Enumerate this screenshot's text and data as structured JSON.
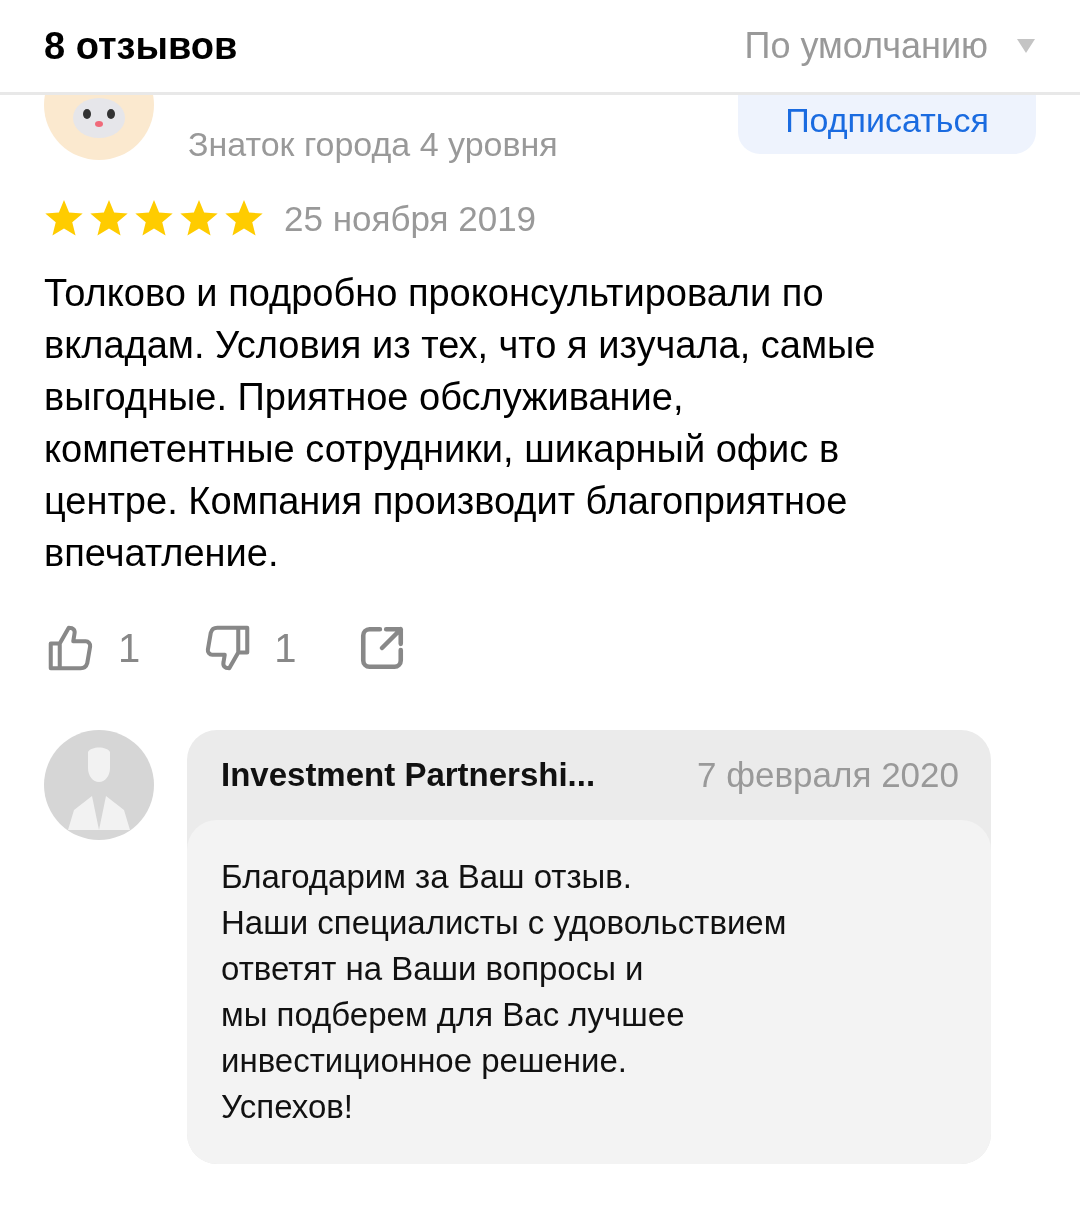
{
  "header": {
    "title": "8 отзывов",
    "sort": "По умолчанию"
  },
  "review": {
    "author_level": "Знаток города 4 уровня",
    "subscribe": "Подписаться",
    "stars": 5,
    "date": "25 ноября 2019",
    "text": "Толково и подробно проконсультировали по вкладам. Условия из тех, что я изучала, самые выгодные. Приятное обслуживание, компетентные сотрудники, шикарный офис в центре. Компания производит благоприятное впечатление.",
    "likes": "1",
    "dislikes": "1"
  },
  "reply": {
    "author": "Investment Partnershi...",
    "date": "7 февраля 2020",
    "text": "Благодарим за Ваш отзыв.\nНаши специалисты с удовольствием\nответят на Ваши вопросы и\nмы подберем для Вас лучшее\nинвестиционное решение.\nУспехов!"
  }
}
